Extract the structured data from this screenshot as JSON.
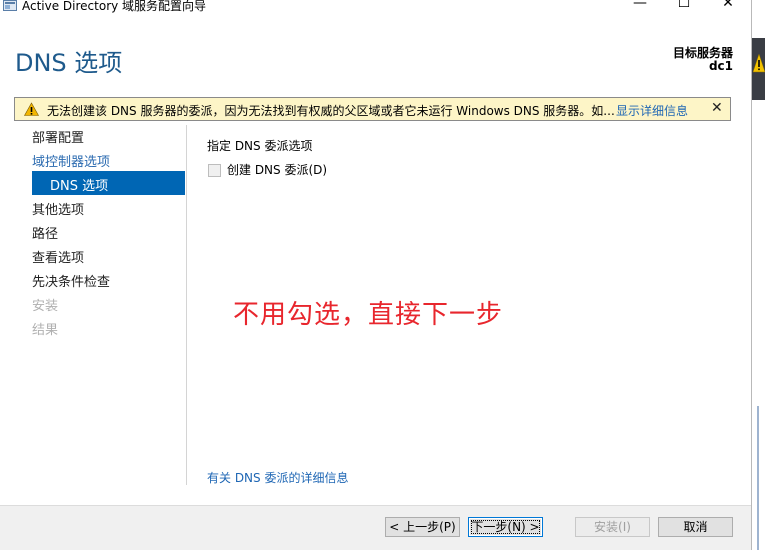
{
  "window": {
    "title": "Active Directory 域服务配置向导",
    "minimize": "—",
    "maximize": "☐",
    "close": "✕"
  },
  "header": {
    "page_title": "DNS 选项",
    "target_server_label": "目标服务器",
    "target_server_value": "dc1"
  },
  "warning": {
    "text": "无法创建该 DNS 服务器的委派，因为无法找到有权威的父区域或者它未运行 Windows DNS 服务器。如...",
    "link": "显示详细信息",
    "close": "✕"
  },
  "nav": {
    "items": [
      {
        "label": "部署配置",
        "state": "normal"
      },
      {
        "label": "域控制器选项",
        "state": "link"
      },
      {
        "label": "DNS 选项",
        "state": "selected"
      },
      {
        "label": "其他选项",
        "state": "normal"
      },
      {
        "label": "路径",
        "state": "normal"
      },
      {
        "label": "查看选项",
        "state": "normal"
      },
      {
        "label": "先决条件检查",
        "state": "normal"
      },
      {
        "label": "安装",
        "state": "disabled"
      },
      {
        "label": "结果",
        "state": "disabled"
      }
    ]
  },
  "content": {
    "section_heading": "指定 DNS 委派选项",
    "checkbox_label": "创建 DNS 委派(D)",
    "checkbox_checked": false,
    "annotation": "不用勾选，直接下一步",
    "more_info_link": "有关 DNS 委派的详细信息"
  },
  "footer": {
    "prev": "< 上一步(P)",
    "next": "下一步(N) >",
    "install": "安装(I)",
    "cancel": "取消"
  },
  "colors": {
    "title_blue": "#1e5a8c",
    "nav_selected": "#0066b4",
    "warning_bg": "#fdf5c7",
    "annotation_red": "#e8262d",
    "link_blue": "#1e66b4"
  }
}
